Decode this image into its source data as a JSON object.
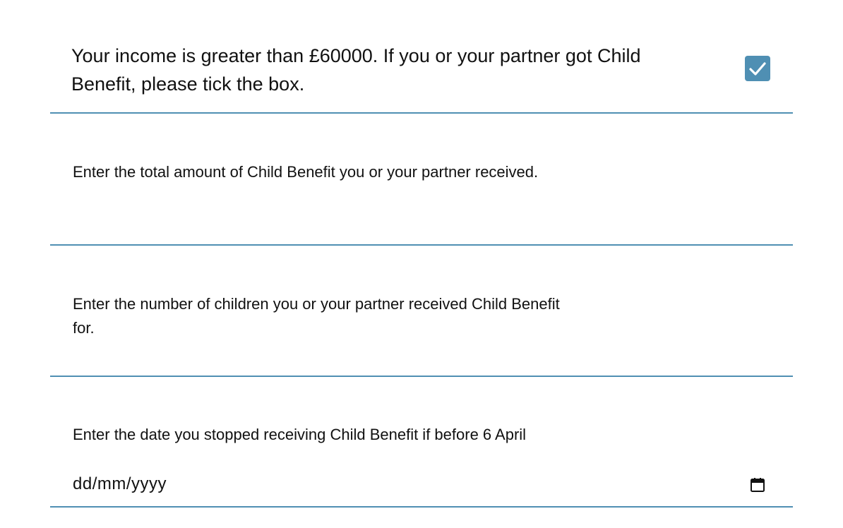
{
  "income_question": {
    "text": "Your income is greater than £60000. If you or your partner got Child Benefit, please tick the box.",
    "checked": true
  },
  "amount_field": {
    "label": "Enter the total amount of Child Benefit you or your partner received.",
    "value": ""
  },
  "children_field": {
    "label": "Enter the number of children you or your partner received Child Benefit for.",
    "value": ""
  },
  "date_field": {
    "label": "Enter the date you stopped receiving Child Benefit if before 6 April",
    "placeholder": "dd/mm/yyyy",
    "icon": "calendar-icon"
  },
  "colors": {
    "accent": "#4f8fb3",
    "text": "#111111"
  }
}
